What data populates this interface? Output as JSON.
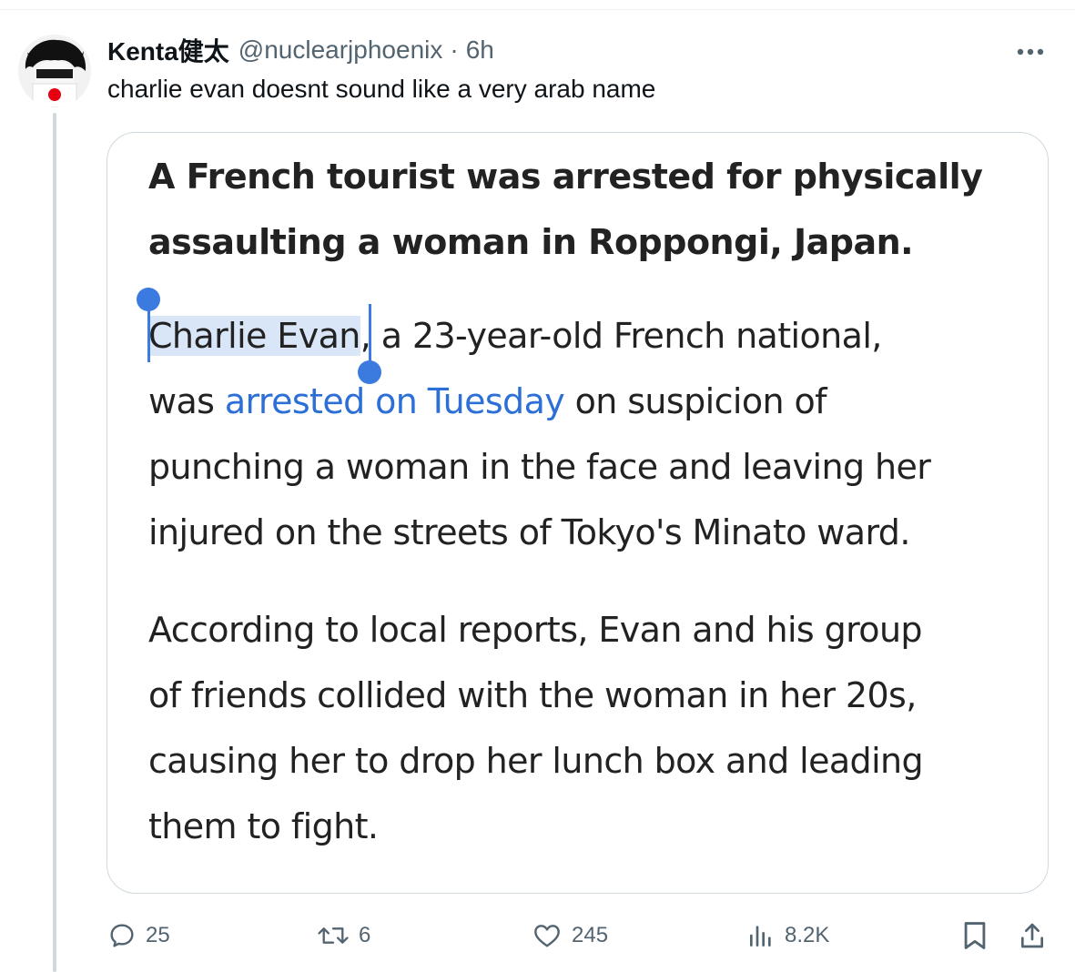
{
  "tweet": {
    "display_name": "Kenta健太",
    "handle": "@nuclearjphoenix",
    "separator": "·",
    "time": "6h",
    "text": "charlie evan doesnt sound like a very arab name"
  },
  "card": {
    "headline_line1": "A French tourist was arrested for physically",
    "headline_line2": "assaulting a woman in Roppongi, Japan.",
    "p1": {
      "selected": "Charlie Evan",
      "after_selected": ", a 23-year-old French national,",
      "line2_start": "was ",
      "link": "arrested on Tuesday",
      "line2_end": " on suspicion of",
      "line3": "punching a woman in the face and leaving her",
      "line4": "injured on the streets of Tokyo's Minato ward."
    },
    "p2": {
      "line1": "According to local reports, Evan and his group",
      "line2": "of friends collided with the woman in her 20s,",
      "line3": "causing her to drop her lunch box and leading",
      "line4": "them to fight."
    }
  },
  "actions": {
    "replies": "25",
    "reposts": "6",
    "likes": "245",
    "views": "8.2K"
  },
  "colors": {
    "text": "#0f1419",
    "secondary": "#536471",
    "link": "#2c6fd6",
    "selection": "#d9e6f8",
    "selection_handle": "#3b7be0",
    "flag_red": "#e60012"
  },
  "icons": [
    "avatar-image",
    "more-icon",
    "reply-icon",
    "repost-icon",
    "like-icon",
    "views-icon",
    "bookmark-icon",
    "share-icon"
  ]
}
